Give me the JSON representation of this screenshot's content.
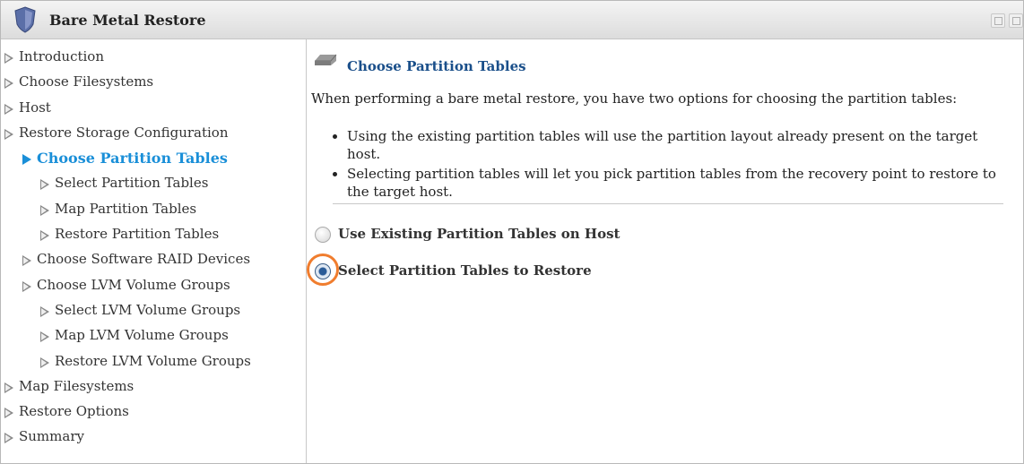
{
  "window": {
    "title": "Bare Metal Restore"
  },
  "sidebar": {
    "items": [
      {
        "label": "Introduction",
        "level": 0,
        "active": false
      },
      {
        "label": "Choose Filesystems",
        "level": 0,
        "active": false
      },
      {
        "label": "Host",
        "level": 0,
        "active": false
      },
      {
        "label": "Restore Storage Configuration",
        "level": 0,
        "active": false
      },
      {
        "label": "Choose Partition Tables",
        "level": 1,
        "active": true
      },
      {
        "label": "Select Partition Tables",
        "level": 2,
        "active": false
      },
      {
        "label": "Map Partition Tables",
        "level": 2,
        "active": false
      },
      {
        "label": "Restore Partition Tables",
        "level": 2,
        "active": false
      },
      {
        "label": "Choose Software RAID Devices",
        "level": 1,
        "active": false
      },
      {
        "label": "Choose LVM Volume Groups",
        "level": 1,
        "active": false
      },
      {
        "label": "Select LVM Volume Groups",
        "level": 2,
        "active": false
      },
      {
        "label": "Map LVM Volume Groups",
        "level": 2,
        "active": false
      },
      {
        "label": "Restore LVM Volume Groups",
        "level": 2,
        "active": false
      },
      {
        "label": "Map Filesystems",
        "level": 0,
        "active": false
      },
      {
        "label": "Restore Options",
        "level": 0,
        "active": false
      },
      {
        "label": "Summary",
        "level": 0,
        "active": false
      }
    ]
  },
  "main": {
    "section_title": "Choose Partition Tables",
    "intro": "When performing a bare metal restore, you have two options for choosing the partition tables:",
    "bullets": [
      "Using the existing partition tables will use the partition layout already present on the target host.",
      "Selecting partition tables will let you pick partition tables from the recovery point to restore to the target host."
    ],
    "options": [
      {
        "label": "Use Existing Partition Tables on Host",
        "checked": false
      },
      {
        "label": "Select Partition Tables to Restore",
        "checked": true
      }
    ]
  },
  "colors": {
    "active_nav": "#1a8fd8",
    "section_title": "#1a4f8a",
    "highlight_ring": "#f07d2e"
  },
  "icons": {
    "app": "shield-icon",
    "section": "disk-icon",
    "nav_arrow": "triangle-right-icon"
  }
}
